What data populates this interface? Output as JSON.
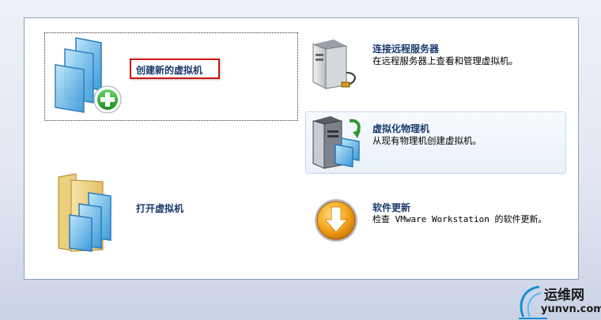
{
  "actions": {
    "create": {
      "title": "创建新的虚拟机"
    },
    "open": {
      "title": "打开虚拟机"
    },
    "connect": {
      "title": "连接远程服务器",
      "description": "在远程服务器上查看和管理虚拟机。"
    },
    "virtualize": {
      "title": "虚拟化物理机",
      "description": "从现有物理机创建虚拟机。"
    },
    "update": {
      "title": "软件更新",
      "description": "检查 VMware Workstation 的软件更新。"
    }
  },
  "watermark": {
    "name": "运维网",
    "url": "yunvn.com"
  },
  "icons": {
    "create": "vm-windows-plus-icon",
    "open": "folder-windows-icon",
    "connect": "server-tower-icon",
    "virtualize": "computer-to-vm-icon",
    "update": "download-arrow-icon"
  },
  "colors": {
    "highlight_border": "#d01212",
    "title_text": "#1a3a6e",
    "panel_border": "#8aa0c4"
  }
}
